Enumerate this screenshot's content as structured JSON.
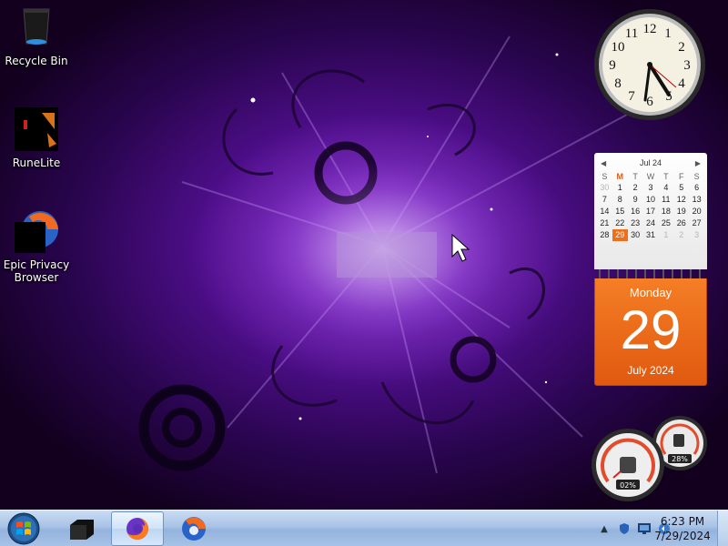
{
  "desktop_icons": [
    {
      "label": "Recycle Bin",
      "icon": "recycle-bin-icon"
    },
    {
      "label": "RuneLite",
      "icon": "runelite-icon"
    },
    {
      "label": "Epic Privacy Browser",
      "icon": "epic-browser-icon"
    }
  ],
  "calendar": {
    "month_label": "Jul 24",
    "day_headers": [
      "S",
      "M",
      "T",
      "W",
      "T",
      "F",
      "S"
    ],
    "weeks": [
      [
        "30",
        "1",
        "2",
        "3",
        "4",
        "5",
        "6"
      ],
      [
        "7",
        "8",
        "9",
        "10",
        "11",
        "12",
        "13"
      ],
      [
        "14",
        "15",
        "16",
        "17",
        "18",
        "19",
        "20"
      ],
      [
        "21",
        "22",
        "23",
        "24",
        "25",
        "26",
        "27"
      ],
      [
        "28",
        "29",
        "30",
        "31",
        "1",
        "2",
        "3"
      ]
    ],
    "weekday": "Monday",
    "day": "29",
    "month_year": "July 2024"
  },
  "meters": {
    "cpu": "02%",
    "memory": "28%"
  },
  "taskbar": {
    "time": "6:23 PM",
    "date": "7/29/2024",
    "pinned": [
      "file-explorer-icon",
      "firefox-icon",
      "epic-browser-icon"
    ]
  },
  "colors": {
    "accent": "#ee6f1c",
    "wallpaper": "#4e0e8a",
    "taskbar": "#a9c3e6"
  }
}
